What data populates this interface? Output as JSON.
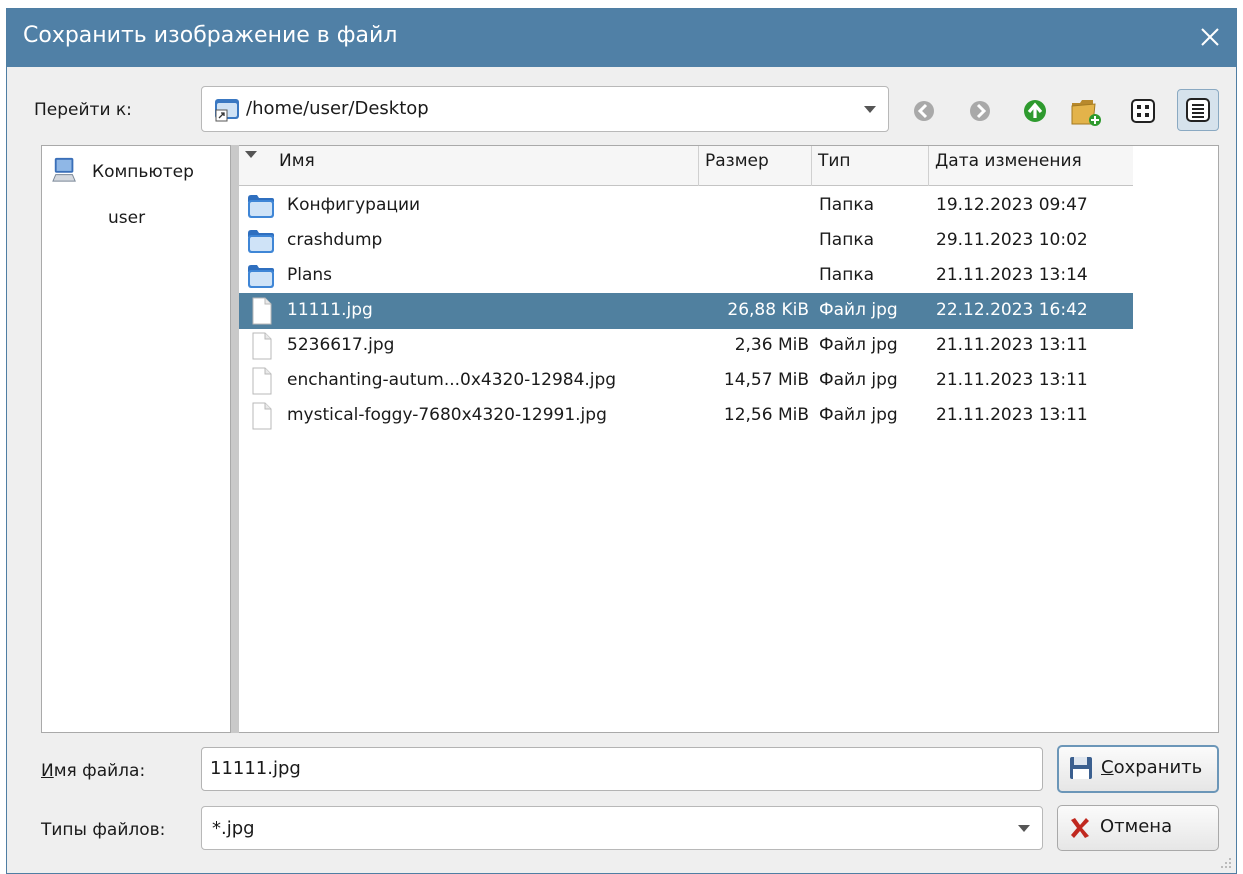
{
  "window": {
    "title": "Сохранить изображение в файл"
  },
  "location": {
    "label": "Перейти к:",
    "path": "/home/user/Desktop"
  },
  "toolbar": {
    "icons": [
      "back-icon",
      "forward-icon",
      "up-icon",
      "new-folder-icon",
      "icon-view-icon",
      "detail-view-icon"
    ]
  },
  "sidebar": {
    "items": [
      {
        "label": "Компьютер",
        "icon": "computer-icon"
      },
      {
        "label": "user",
        "icon": ""
      }
    ]
  },
  "table": {
    "columns": {
      "name": "Имя",
      "size": "Размер",
      "type": "Тип",
      "date": "Дата изменения"
    },
    "rows": [
      {
        "name": "Конфигурации",
        "size": "",
        "type": "Папка",
        "date": "19.12.2023 09:47",
        "kind": "folder",
        "selected": false
      },
      {
        "name": "crashdump",
        "size": "",
        "type": "Папка",
        "date": "29.11.2023 10:02",
        "kind": "folder",
        "selected": false
      },
      {
        "name": "Plans",
        "size": "",
        "type": "Папка",
        "date": "21.11.2023 13:14",
        "kind": "folder",
        "selected": false
      },
      {
        "name": "11111.jpg",
        "size": "26,88 KiB",
        "type": "Файл jpg",
        "date": "22.12.2023 16:42",
        "kind": "file",
        "selected": true
      },
      {
        "name": "5236617.jpg",
        "size": "2,36 MiB",
        "type": "Файл jpg",
        "date": "21.11.2023 13:11",
        "kind": "file",
        "selected": false
      },
      {
        "name": "enchanting-autum...0x4320-12984.jpg",
        "size": "14,57 MiB",
        "type": "Файл jpg",
        "date": "21.11.2023 13:11",
        "kind": "file",
        "selected": false
      },
      {
        "name": "mystical-foggy-7680x4320-12991.jpg",
        "size": "12,56 MiB",
        "type": "Файл jpg",
        "date": "21.11.2023 13:11",
        "kind": "file",
        "selected": false
      }
    ]
  },
  "filename": {
    "label_mnemonic": "И",
    "label_rest": "мя файла:",
    "value": "11111.jpg"
  },
  "filetypes": {
    "label": "Типы файлов:",
    "value": "*.jpg"
  },
  "buttons": {
    "save_mnemonic": "С",
    "save_rest": "охранить",
    "cancel": "Отмена"
  },
  "colors": {
    "titlebar": "#5080a6",
    "selection": "#50809f",
    "background": "#efefef"
  }
}
